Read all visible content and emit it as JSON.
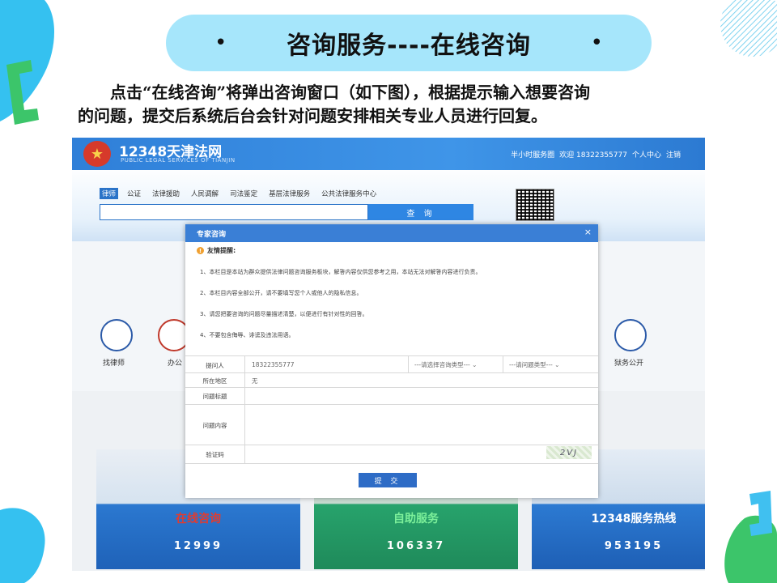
{
  "slide": {
    "title": "咨询服务----在线咨询",
    "bullet_left": "•",
    "bullet_right": "•",
    "intro_line1": "点击“在线咨询”将弹出咨询窗口（如下图），根据提示输入想要咨询",
    "intro_line2": "的问题，提交后系统后台会针对问题安排相关专业人员进行回复。"
  },
  "site": {
    "name": "12348天津法网",
    "subtitle": "PUBLIC LEGAL SERVICES OF TIANJIN",
    "header_links": [
      "半小时服务圈",
      "欢迎 18322355777",
      "个人中心",
      "注销"
    ],
    "nav_tabs": [
      "律师",
      "公证",
      "法律援助",
      "人民调解",
      "司法鉴定",
      "基层法律服务",
      "公共法律服务中心"
    ],
    "search_button": "查 询",
    "services": [
      "找律师",
      "办公",
      "狱务公开"
    ],
    "cards": [
      {
        "title": "在线咨询",
        "count": "12999"
      },
      {
        "title": "自助服务",
        "count": "106337"
      },
      {
        "title": "12348服务热线",
        "count": "953195"
      }
    ]
  },
  "modal": {
    "title": "专家咨询",
    "close": "×",
    "tips_title": "友情提醒:",
    "tips": [
      "1、本栏目是本站为群众提供法律问题咨询服务板块，解答内容仅供您参考之用，本站无法对解答内容进行负责。",
      "2、本栏目内容全部公开，请不要填写您个人或他人的隐私信息。",
      "3、请您把要咨询的问题尽量描述清楚，以便进行有针对性的回答。",
      "4、不要包含侮辱、诽谤及违法用语。"
    ],
    "form": {
      "asker_label": "提问人",
      "asker_value": "18322355777",
      "consult_type": "---请选择咨询类型---",
      "question_type": "---请问题类型---",
      "region_label": "所在地区",
      "region_value": "无",
      "subject_label": "问题标题",
      "content_label": "问题内容",
      "captcha_label": "验证码",
      "captcha_value": "2VJ"
    },
    "submit": "提 交"
  },
  "colors": {
    "pill": "#a6e6fb",
    "header_blue": "#3f95e8",
    "modal_blue": "#3a7fd6"
  }
}
